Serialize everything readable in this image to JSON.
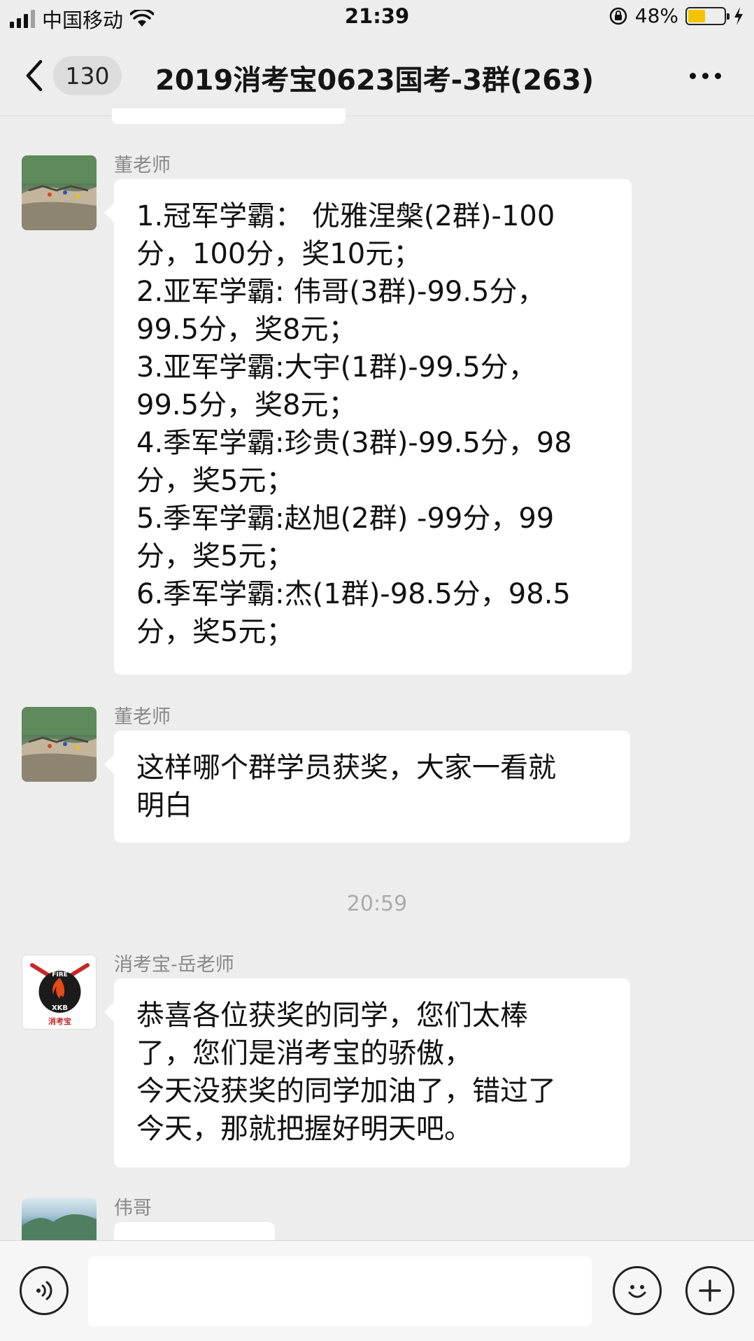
{
  "status_bar": {
    "carrier": "中国移动",
    "time": "21:39",
    "battery_percent": "48%"
  },
  "header": {
    "unread_count": "130",
    "title": "2019消考宝0623国考-3群(263)"
  },
  "messages": [
    {
      "sender": "董老师",
      "avatar_icon": "mountain-cliff-avatar",
      "lines": [
        "1.冠军学霸： 优雅涅槃(2群)-100",
        "分，100分，奖10元；",
        "2.亚军学霸: 伟哥(3群)-99.5分，",
        "99.5分，奖8元；",
        "3.亚军学霸:大宇(1群)-99.5分，",
        "99.5分，奖8元；",
        "4.季军学霸:珍贵(3群)-99.5分，98",
        "分，奖5元；",
        "5.季军学霸:赵旭(2群) -99分，99",
        "分，奖5元；",
        "6.季军学霸:杰(1群)-98.5分，98.5",
        "分，奖5元；"
      ]
    },
    {
      "sender": "董老师",
      "avatar_icon": "mountain-cliff-avatar",
      "lines": [
        "这样哪个群学员获奖，大家一看就",
        "明白"
      ]
    },
    {
      "sender": "消考宝-岳老师",
      "avatar_icon": "fire-xkb-logo-avatar",
      "lines": [
        "恭喜各位获奖的同学，您们太棒",
        "了，您们是消考宝的骄傲，",
        "今天没获奖的同学加油了，错过了",
        "今天，那就把握好明天吧。"
      ]
    },
    {
      "sender": "伟哥",
      "avatar_icon": "landscape-avatar",
      "lines": []
    }
  ],
  "timestamp": "20:59",
  "logo": {
    "top_text": "FIRE",
    "bottom_text": "XKB",
    "caption": "消考宝"
  },
  "input_bar": {
    "voice_icon": "voice-icon",
    "emoji_icon": "emoji-icon",
    "plus_icon": "plus-icon"
  },
  "colors": {
    "background": "#ededed",
    "bubble": "#ffffff",
    "battery_fill": "#f5c400"
  }
}
